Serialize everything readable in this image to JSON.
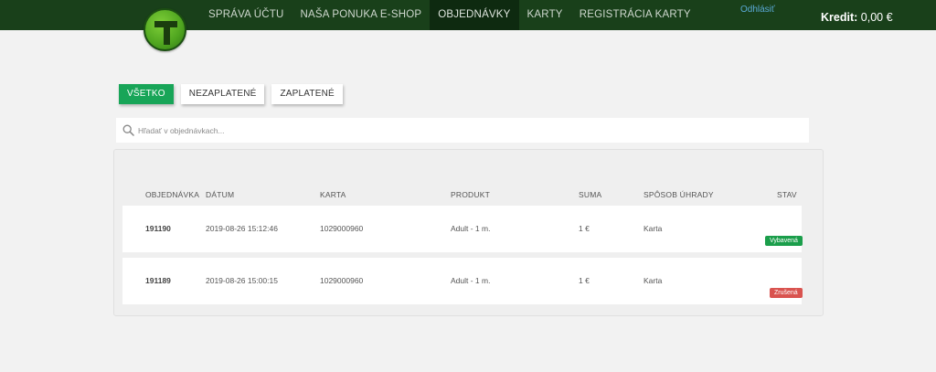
{
  "nav": {
    "items": [
      {
        "label": "SPRÁVA ÚČTU",
        "active": false
      },
      {
        "label": "NAŠA PONUKA E-SHOP",
        "active": false
      },
      {
        "label": "OBJEDNÁVKY",
        "active": true
      },
      {
        "label": "KARTY",
        "active": false
      },
      {
        "label": "REGISTRÁCIA KARTY",
        "active": false
      }
    ],
    "logout": "Odhlásiť",
    "credit_label": "Kredit:",
    "credit_value": "0,00 €",
    "brand_color": "#19401a"
  },
  "filters": [
    {
      "label": "VŠETKO",
      "active": true
    },
    {
      "label": "NEZAPLATENÉ",
      "active": false
    },
    {
      "label": "ZAPLATENÉ",
      "active": false
    }
  ],
  "search": {
    "icon": "search-icon",
    "placeholder": "Hľadať v objednávkach..."
  },
  "table": {
    "columns": [
      "OBJEDNÁVKA",
      "DÁTUM",
      "KARTA",
      "PRODUKT",
      "SUMA",
      "SPÔSOB ÚHRADY",
      "STAV"
    ],
    "rows": [
      {
        "order": "191190",
        "date": "2019-08-26 15:12:46",
        "card": "1029000960",
        "product": "Adult - 1 m.",
        "amount": "1 €",
        "payment": "Karta",
        "status": "Vybavená",
        "status_color": "#1b9e4b"
      },
      {
        "order": "191189",
        "date": "2019-08-26 15:00:15",
        "card": "1029000960",
        "product": "Adult - 1 m.",
        "amount": "1 €",
        "payment": "Karta",
        "status": "Zrušená",
        "status_color": "#d9534f"
      }
    ]
  }
}
